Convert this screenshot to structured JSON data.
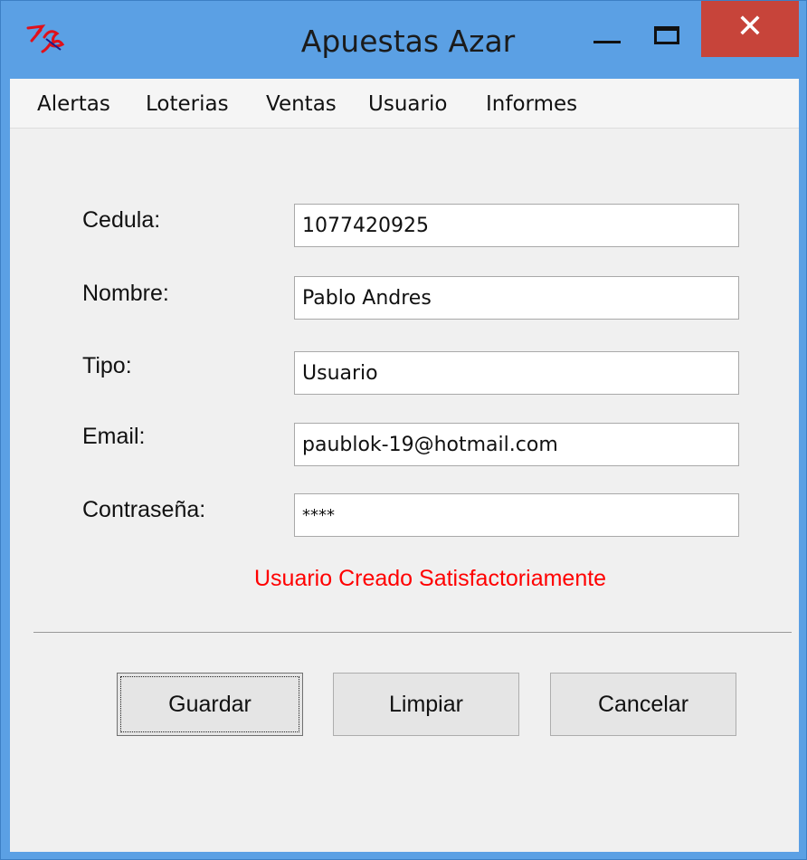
{
  "window": {
    "title": "Apuestas Azar",
    "close_glyph": "✕",
    "icons": {
      "app": "tk-feather-icon",
      "minimize": "minimize-icon",
      "maximize": "maximize-icon",
      "close": "close-icon"
    },
    "colors": {
      "titlebar": "#5ba0e4",
      "close": "#c7443a"
    }
  },
  "menu": {
    "items": [
      {
        "label": "Alertas"
      },
      {
        "label": "Loterias"
      },
      {
        "label": "Ventas"
      },
      {
        "label": "Usuario"
      },
      {
        "label": "Informes"
      }
    ]
  },
  "form": {
    "fields": [
      {
        "label": "Cedula:",
        "value": "1077420925"
      },
      {
        "label": "Nombre:",
        "value": "Pablo Andres"
      },
      {
        "label": "Tipo:",
        "value": "Usuario"
      },
      {
        "label": "Email:",
        "value": "paublok-19@hotmail.com"
      },
      {
        "label": "Contraseña:",
        "value": "****"
      }
    ],
    "status": "Usuario Creado Satisfactoriamente",
    "status_color": "#ff0000"
  },
  "buttons": {
    "save": "Guardar",
    "clear": "Limpiar",
    "cancel": "Cancelar"
  }
}
